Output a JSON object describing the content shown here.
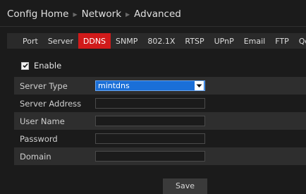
{
  "breadcrumb": {
    "items": [
      "Config Home",
      "Network",
      "Advanced"
    ]
  },
  "tabs": [
    "Port",
    "Server",
    "DDNS",
    "SNMP",
    "802.1X",
    "RTSP",
    "UPnP",
    "Email",
    "FTP",
    "QoS"
  ],
  "active_tab": "DDNS",
  "enable": {
    "label": "Enable",
    "checked": true
  },
  "form": {
    "server_type": {
      "label": "Server Type",
      "value": "mintdns"
    },
    "server_address": {
      "label": "Server Address",
      "value": ""
    },
    "user_name": {
      "label": "User Name",
      "value": ""
    },
    "password": {
      "label": "Password",
      "value": ""
    },
    "domain": {
      "label": "Domain",
      "value": ""
    }
  },
  "save_label": "Save",
  "colors": {
    "accent_tab": "#d11a1a",
    "select_bg": "#1a6fd8",
    "background": "#1b1b1b"
  }
}
